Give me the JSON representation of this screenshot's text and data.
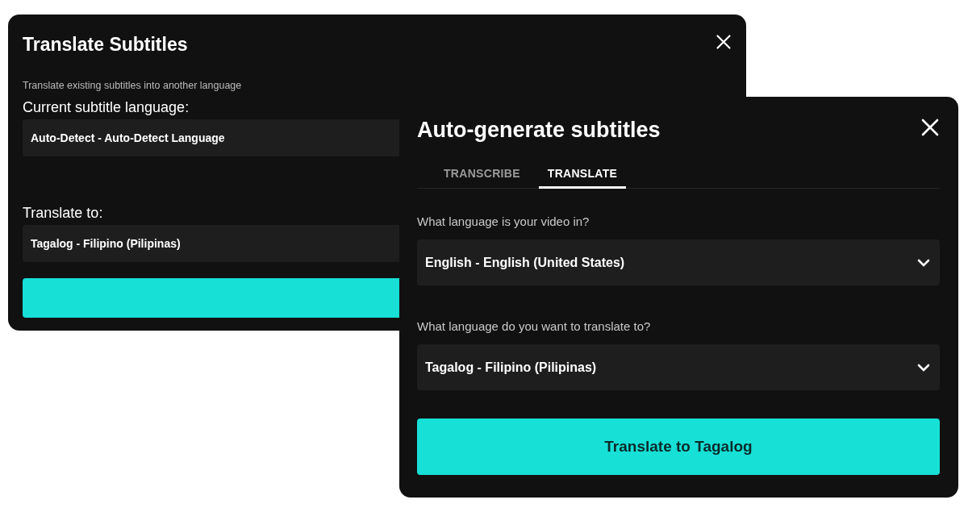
{
  "back_dialog": {
    "title": "Translate Subtitles",
    "description": "Translate existing subtitles into another language",
    "fields": [
      {
        "label": "Current subtitle language:",
        "value": "Auto-Detect - Auto-Detect Language"
      },
      {
        "label": "Translate to:",
        "value": "Tagalog - Filipino (Pilipinas)"
      }
    ]
  },
  "front_dialog": {
    "title": "Auto-generate subtitles",
    "tabs": [
      {
        "label": "TRANSCRIBE",
        "selected": false
      },
      {
        "label": "TRANSLATE",
        "selected": true
      }
    ],
    "fields": [
      {
        "label": "What language is your video in?",
        "value": "English - English (United States)"
      },
      {
        "label": "What language do you want to translate to?",
        "value": "Tagalog - Filipino (Pilipinas)"
      }
    ],
    "button": "Translate to Tagalog"
  }
}
